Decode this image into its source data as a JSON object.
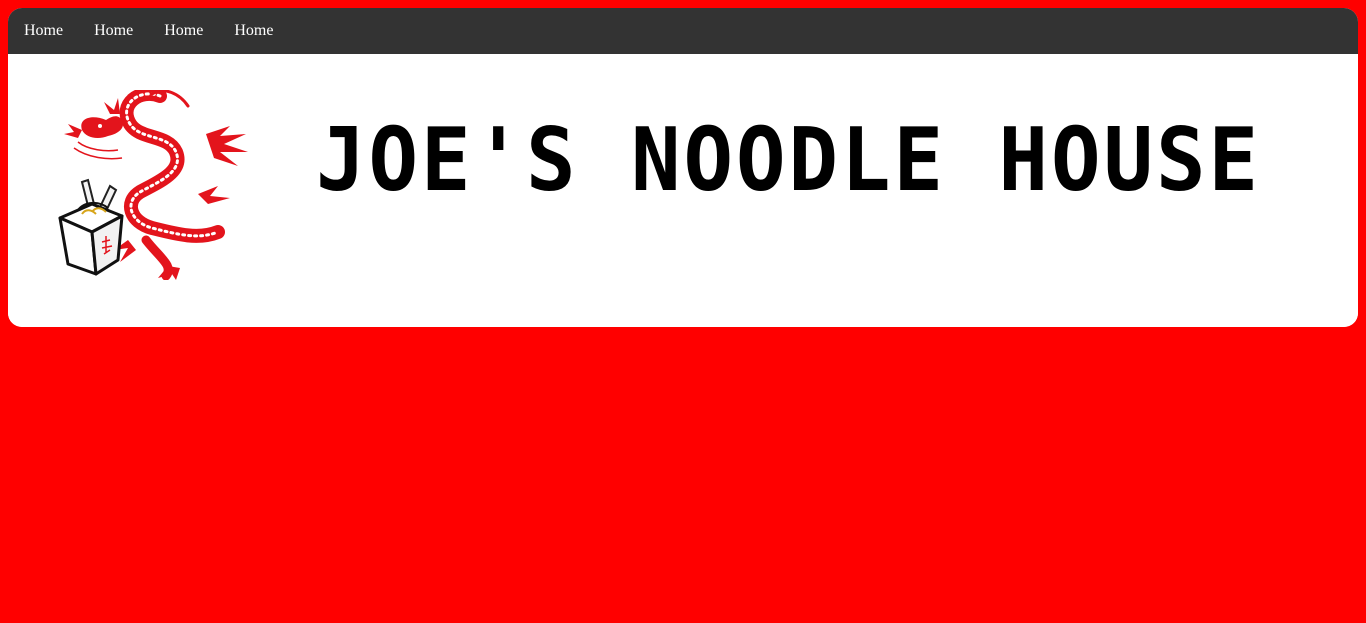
{
  "nav": {
    "links": [
      {
        "label": "Home"
      },
      {
        "label": "Home"
      },
      {
        "label": "Home"
      },
      {
        "label": "Home"
      }
    ]
  },
  "header": {
    "title": "JOE'S NOODLE HOUSE",
    "logo_icon": "dragon-takeout-box-icon"
  },
  "colors": {
    "page_background": "#ff0000",
    "navbar_background": "#333333",
    "nav_text": "#ffffff",
    "header_background": "#ffffff",
    "title_text": "#000000",
    "logo_accent": "#e3141c"
  }
}
